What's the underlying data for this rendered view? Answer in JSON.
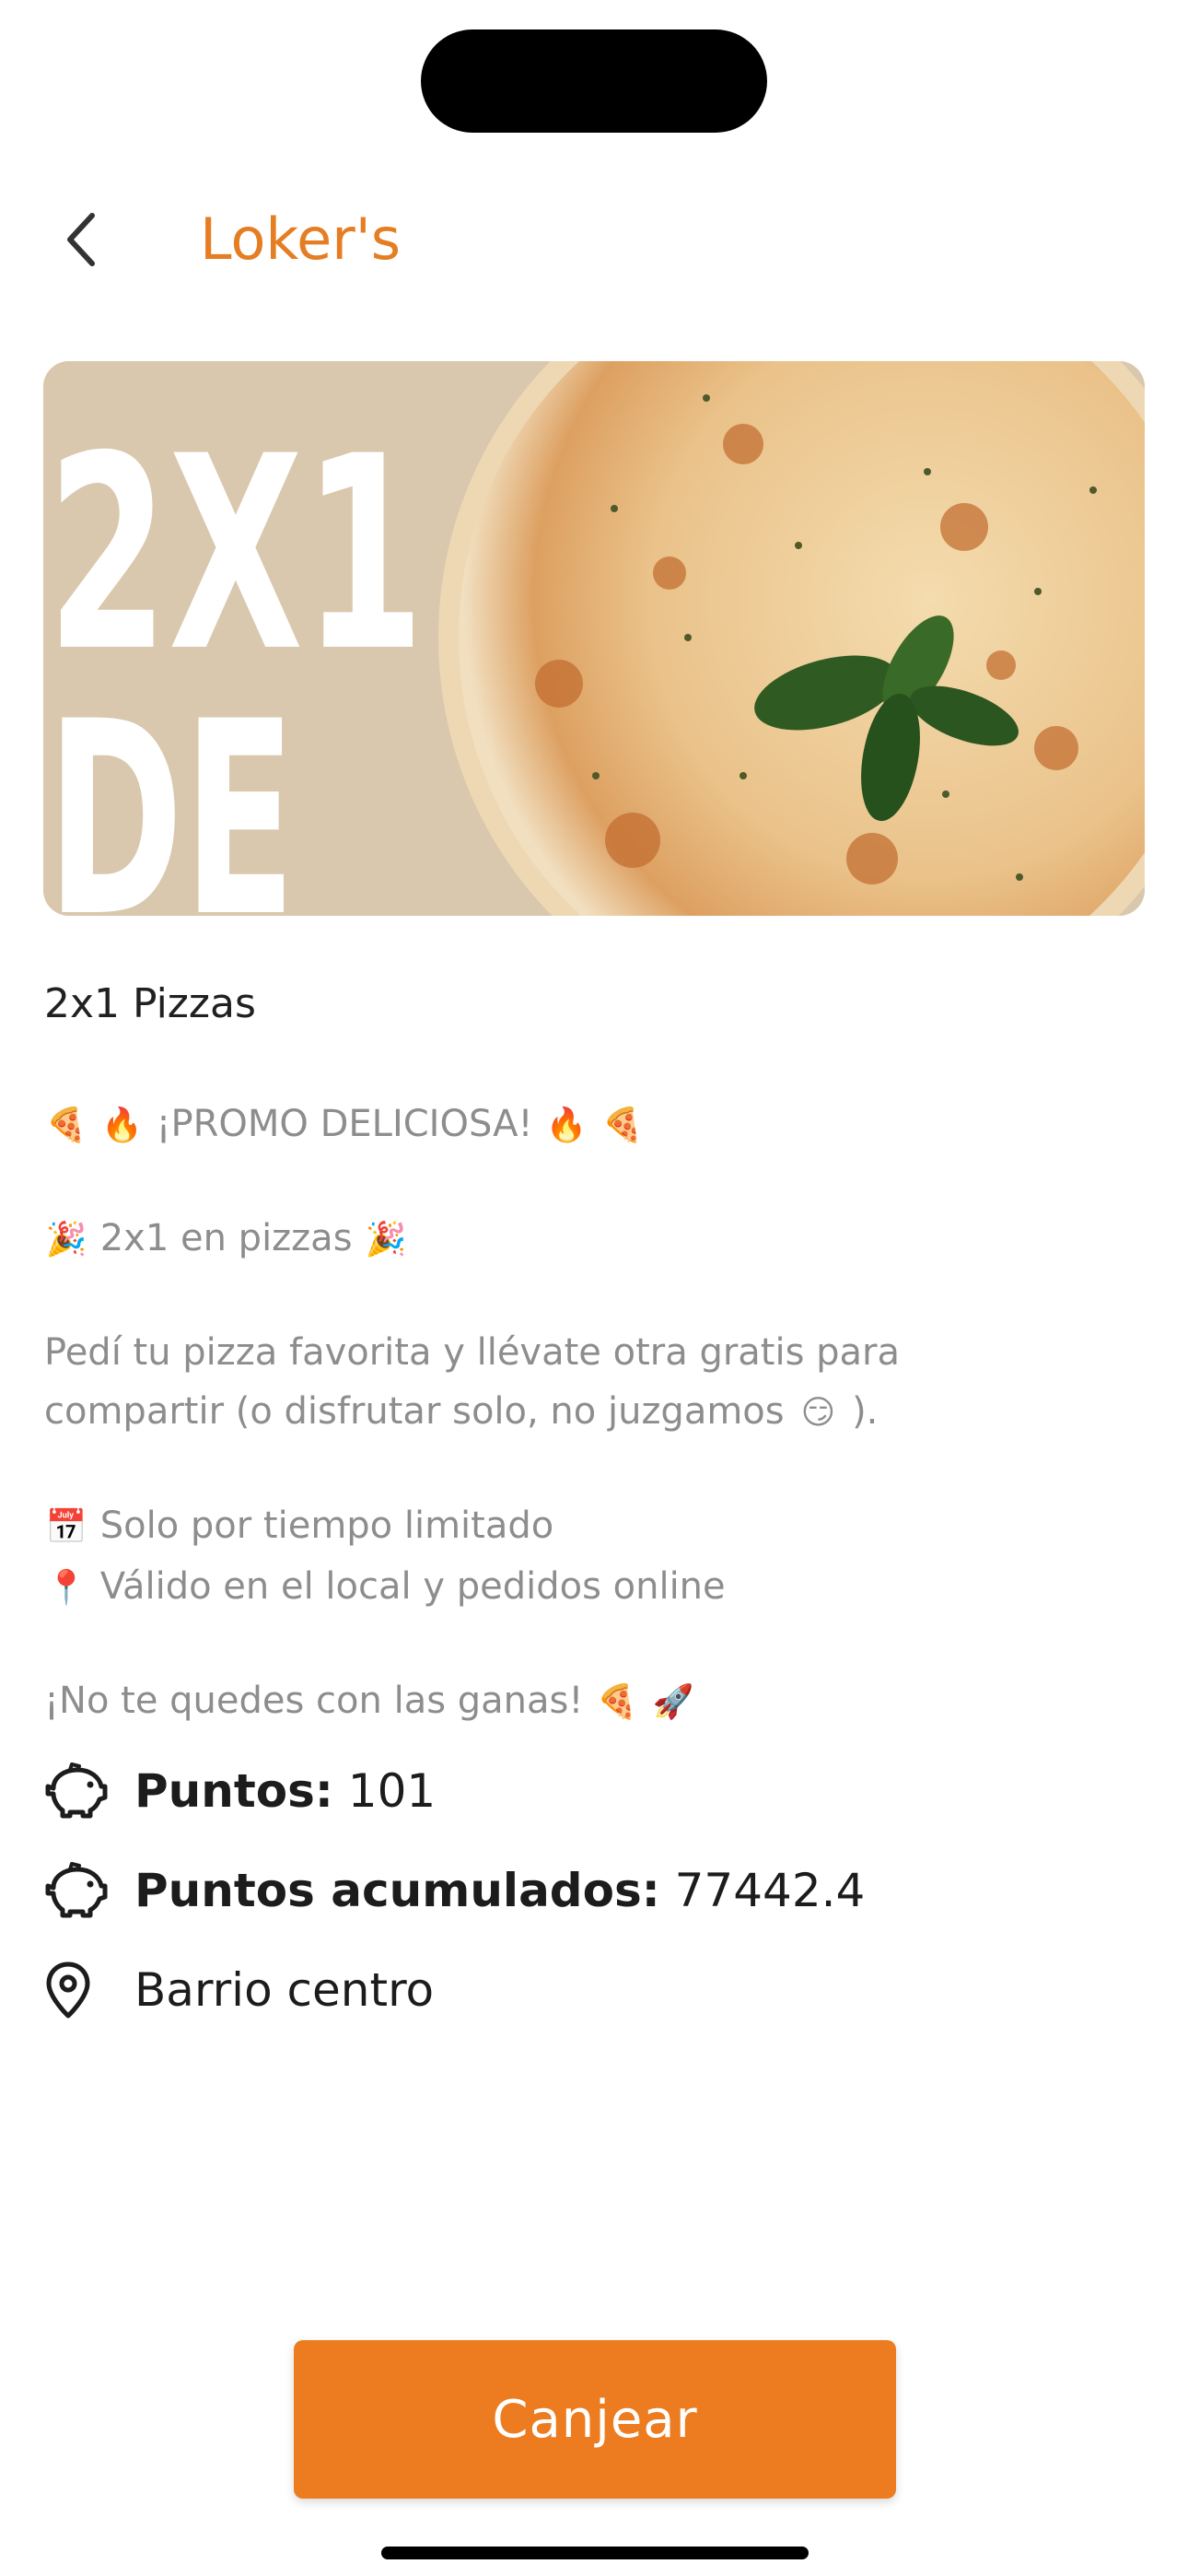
{
  "header": {
    "title": "Loker's",
    "back_icon": "chevron-left-icon"
  },
  "banner": {
    "promo_line1": "2X1",
    "promo_line2": "DE",
    "image": "pizza-margherita-with-basil"
  },
  "promo": {
    "title": "2x1 Pizzas",
    "lines": [
      {
        "icons": [
          "🍕",
          "🔥"
        ],
        "text": "¡PROMO DELICIOSA!",
        "icons_after": [
          "🔥",
          "🍕"
        ]
      },
      {
        "icons": [
          "🎉"
        ],
        "text": "2x1 en pizzas",
        "icons_after": [
          "🎉"
        ]
      },
      {
        "text": "Pedí tu pizza favorita y llévate otra gratis para"
      },
      {
        "text": "compartir (o disfrutar solo, no juzgamos",
        "icons_after": [
          "😏"
        ],
        "suffix": ")."
      },
      {
        "icons": [
          "📅"
        ],
        "text": "Solo por tiempo limitado"
      },
      {
        "icons": [
          "📍"
        ],
        "text": "Válido en el local y pedidos online"
      },
      {
        "text": "¡No te quedes con las ganas!",
        "icons_after": [
          "🍕",
          "🚀"
        ]
      }
    ]
  },
  "info": {
    "points_label": "Puntos:",
    "points_value": "101",
    "acc_label": "Puntos acumulados:",
    "acc_value": "77442.4",
    "location": "Barrio centro",
    "points_icon": "piggy-bank-icon",
    "location_icon": "location-pin-icon"
  },
  "cta": {
    "label": "Canjear"
  },
  "colors": {
    "accent": "#ec7c1f",
    "title": "#e57e22",
    "muted": "#8d8d8d"
  }
}
